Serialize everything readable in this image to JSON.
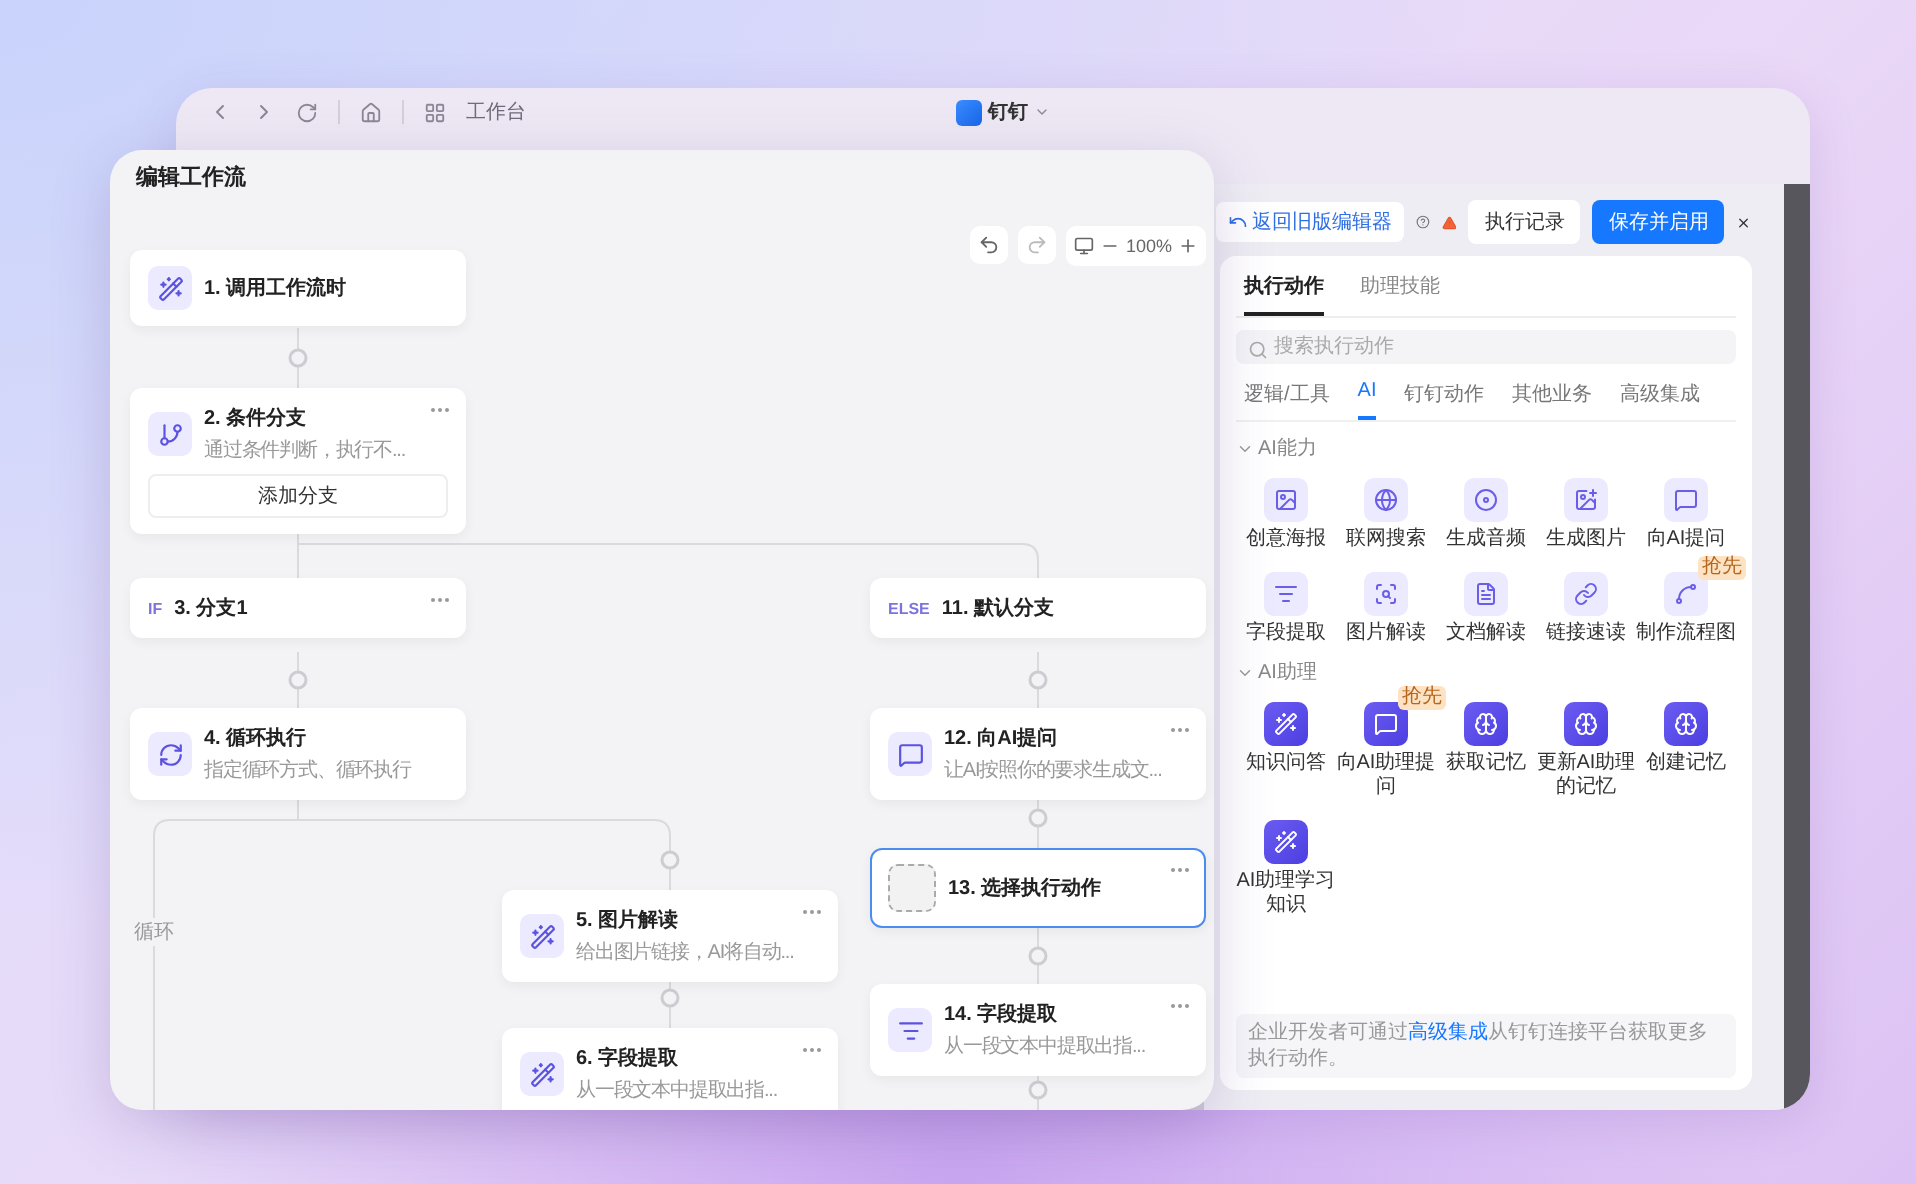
{
  "browser": {
    "workspace_label": "工作台",
    "app_title": "钉钉"
  },
  "editor": {
    "title": "编辑工作流",
    "zoom": "100%",
    "loop_label": "循环",
    "nodes": [
      {
        "kind": "step",
        "title": "1. 调用工作流时",
        "menu": false,
        "selected": false
      },
      {
        "kind": "step",
        "title": "2. 条件分支",
        "description": "通过条件判断，执行不...",
        "button": "添加分支",
        "menu": true,
        "selected": false
      },
      {
        "kind": "branch",
        "tag": "IF",
        "title": "3. 分支1",
        "menu": true,
        "selected": false
      },
      {
        "kind": "branch",
        "tag": "ELSE",
        "title": "11. 默认分支",
        "menu": false,
        "selected": false
      },
      {
        "kind": "step",
        "title": "4. 循环执行",
        "description": "指定循环方式、循环执行",
        "menu": false,
        "selected": false
      },
      {
        "kind": "step",
        "title": "12. 向AI提问",
        "description": "让AI按照你的要求生成文...",
        "menu": true,
        "selected": false
      },
      {
        "kind": "empty",
        "title": "13. 选择执行动作",
        "menu": true,
        "selected": true
      },
      {
        "kind": "step",
        "title": "5. 图片解读",
        "description": "给出图片链接，AI将自动...",
        "menu": true,
        "selected": false
      },
      {
        "kind": "step",
        "title": "14. 字段提取",
        "description": "从一段文本中提取出指...",
        "menu": true,
        "selected": false
      },
      {
        "kind": "step",
        "title": "6. 字段提取",
        "description": "从一段文本中提取出指...",
        "menu": true,
        "selected": false
      }
    ]
  },
  "action_panel": {
    "back_link": "返回旧版编辑器",
    "buttons": [
      {
        "label": "执行记录",
        "kind": "default"
      },
      {
        "label": "保存并启用",
        "kind": "primary"
      }
    ],
    "tabs": [
      {
        "label": "执行动作",
        "selected": true
      },
      {
        "label": "助理技能",
        "selected": false
      }
    ],
    "search": {
      "placeholder": "搜索执行动作"
    },
    "categories": [
      {
        "label": "逻辑/工具",
        "selected": false
      },
      {
        "label": "AI",
        "selected": true
      },
      {
        "label": "钉钉动作",
        "selected": false
      },
      {
        "label": "其他业务",
        "selected": false
      },
      {
        "label": "高级集成",
        "selected": false
      }
    ],
    "sections": [
      {
        "title": "AI能力",
        "expanded": true,
        "items": [
          {
            "label": "创意海报"
          },
          {
            "label": "联网搜索"
          },
          {
            "label": "生成音频"
          },
          {
            "label": "生成图片"
          },
          {
            "label": "向AI提问"
          },
          {
            "label": "字段提取"
          },
          {
            "label": "图片解读"
          },
          {
            "label": "文档解读"
          },
          {
            "label": "链接速读"
          },
          {
            "label": "制作流程图",
            "badge": "抢先"
          }
        ]
      },
      {
        "title": "AI助理",
        "expanded": true,
        "items": [
          {
            "label": "知识问答"
          },
          {
            "label": "向AI助理提问",
            "badge": "抢先"
          },
          {
            "label": "获取记忆"
          },
          {
            "label": "更新AI助理的记忆"
          },
          {
            "label": "创建记忆"
          },
          {
            "label": "AI助理学习知识"
          }
        ]
      }
    ],
    "footer": {
      "before": "企业开发者可通过",
      "link": "高级集成",
      "after": "从钉钉连接平台获取更多执行动作。"
    }
  }
}
